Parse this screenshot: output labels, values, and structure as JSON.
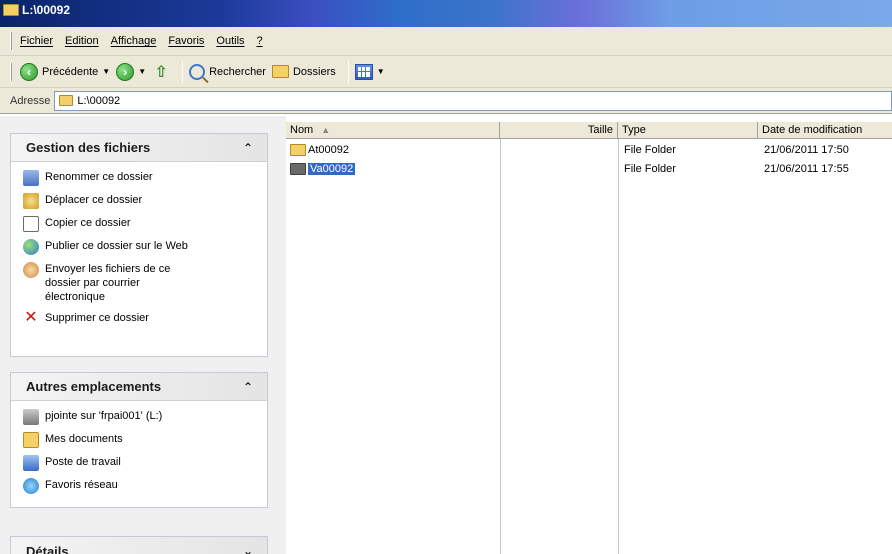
{
  "window": {
    "title": "L:\\00092"
  },
  "menu": [
    "Fichier",
    "Edition",
    "Affichage",
    "Favoris",
    "Outils",
    "?"
  ],
  "toolbar": {
    "back": "Précédente",
    "search": "Rechercher",
    "folders": "Dossiers"
  },
  "address": {
    "label": "Adresse",
    "value": "L:\\00092"
  },
  "tasks": {
    "title": "Gestion des fichiers",
    "items": [
      {
        "label": "Renommer ce dossier",
        "icon": "rename-icon"
      },
      {
        "label": "Déplacer ce dossier",
        "icon": "move-icon"
      },
      {
        "label": "Copier ce dossier",
        "icon": "copy-icon"
      },
      {
        "label": "Publier ce dossier sur le Web",
        "icon": "web-icon"
      },
      {
        "label": "Envoyer les fichiers de ce dossier par courrier électronique",
        "icon": "mail-icon"
      },
      {
        "label": "Supprimer ce dossier",
        "icon": "delete-icon"
      }
    ]
  },
  "places": {
    "title": "Autres emplacements",
    "items": [
      {
        "label": "pjointe sur 'frpai001' (L:)",
        "icon": "network-drive-icon"
      },
      {
        "label": "Mes documents",
        "icon": "documents-icon"
      },
      {
        "label": "Poste de travail",
        "icon": "computer-icon"
      },
      {
        "label": "Favoris réseau",
        "icon": "network-places-icon"
      }
    ]
  },
  "details": {
    "title": "Détails"
  },
  "columns": {
    "name": "Nom",
    "size": "Taille",
    "type": "Type",
    "date": "Date de modification"
  },
  "files": [
    {
      "name": "At00092",
      "size": "",
      "type": "File Folder",
      "date": "21/06/2011 17:50",
      "selected": false
    },
    {
      "name": "Va00092",
      "size": "",
      "type": "File Folder",
      "date": "21/06/2011 17:55",
      "selected": true
    }
  ],
  "colors": {
    "selection": "#316ac5",
    "title_bar": "#0a246a"
  }
}
